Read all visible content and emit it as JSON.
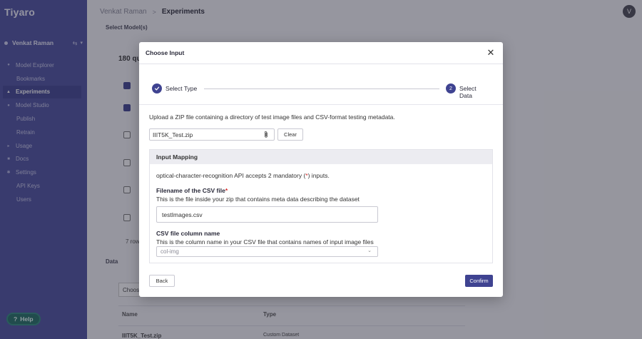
{
  "app": {
    "brand": "Tiyaro"
  },
  "sidebar": {
    "user_name": "Venkat Raman",
    "items": [
      {
        "label": "Model Explorer"
      },
      {
        "label": "Bookmarks"
      },
      {
        "label": "Experiments"
      },
      {
        "label": "Model Studio"
      },
      {
        "label": "Publish"
      },
      {
        "label": "Retrain"
      },
      {
        "label": "Usage"
      },
      {
        "label": "Docs"
      },
      {
        "label": "Settings"
      },
      {
        "label": "API Keys"
      },
      {
        "label": "Users"
      }
    ],
    "help_label": "Help"
  },
  "header": {
    "breadcrumb_user": "Venkat Raman",
    "breadcrumb_sep": ">",
    "breadcrumb_page": "Experiments",
    "avatar_initial": "V"
  },
  "background": {
    "select_models_label": "Select Model(s)",
    "count_text": "180 qu",
    "rows_text": "7 row",
    "data_label": "Data",
    "chooser_text": "Choos",
    "col_name": "Name",
    "col_type": "Type",
    "row_name": "IIIT5K_Test.zip",
    "row_type": "Custom Dataset"
  },
  "modal": {
    "title": "Choose Input",
    "steps": [
      {
        "label": "Select Type",
        "status": "done"
      },
      {
        "number": "2",
        "label": "Select Data",
        "status": "active"
      }
    ],
    "upload_instructions": "Upload a ZIP file containing a directory of test image files and CSV-format testing metadata.",
    "file_name": "IIIT5K_Test.zip",
    "clear_label": "Clear",
    "mapping": {
      "heading": "Input Mapping",
      "accepts_prefix": "optical-character-recognition API accepts 2 mandatory (",
      "accepts_star": "*",
      "accepts_suffix": ") inputs.",
      "field1_label": "Filename of the CSV file",
      "field1_star": "*",
      "field1_desc": "This is the file inside your zip that contains meta data describing the dataset",
      "field1_value": "testImages.csv",
      "field2_label": "CSV file column name",
      "field2_desc": "This is the column name in your CSV file that contains names of input image files",
      "field2_value": "col-img"
    },
    "back_label": "Back",
    "confirm_label": "Confirm"
  },
  "colors": {
    "accent": "#3f4391",
    "sidebar": "#4b4f9e",
    "required": "#d62a2a",
    "help": "#1f6e63"
  }
}
